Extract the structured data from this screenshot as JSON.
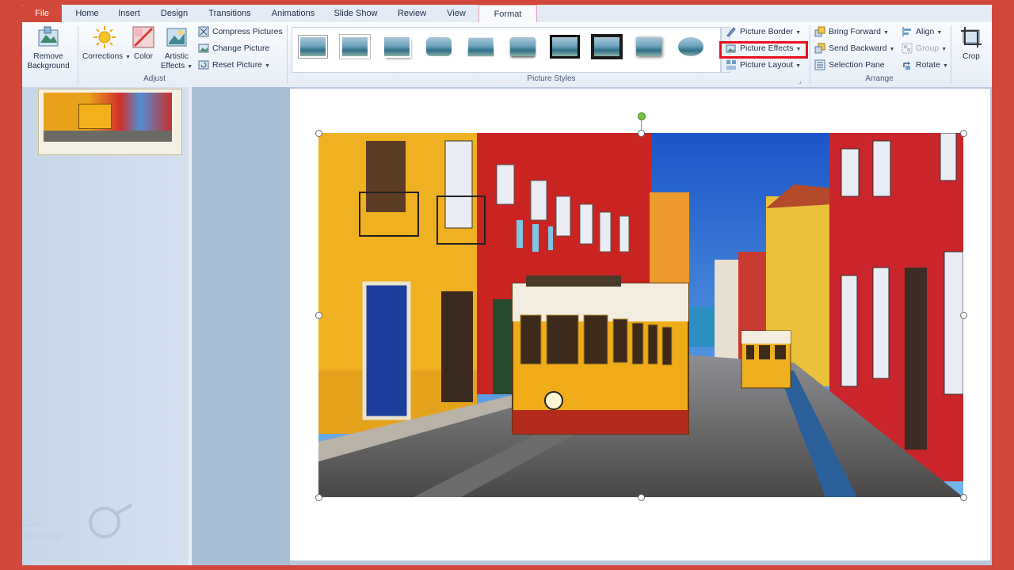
{
  "tabs": [
    "File",
    "Home",
    "Insert",
    "Design",
    "Transitions",
    "Animations",
    "Slide Show",
    "Review",
    "View",
    "Format"
  ],
  "adjust": {
    "remove_background": [
      "Remove",
      "Background"
    ],
    "corrections": "Corrections",
    "color": "Color",
    "artistic_effects": [
      "Artistic",
      "Effects"
    ],
    "compress_pictures": "Compress Pictures",
    "change_picture": "Change Picture",
    "reset_picture": "Reset Picture",
    "group_label": "Adjust"
  },
  "picture_styles": {
    "group_label": "Picture Styles",
    "picture_border": "Picture Border",
    "picture_effects": "Picture Effects",
    "picture_layout": "Picture Layout"
  },
  "arrange": {
    "group_label": "Arrange",
    "bring_forward": "Bring Forward",
    "send_backward": "Send Backward",
    "selection_pane": "Selection Pane",
    "align": "Align",
    "group": "Group",
    "rotate": "Rotate"
  },
  "size": {
    "crop": "Crop"
  },
  "watermark": {
    "text_top": "تک",
    "text_bottom": "TECH VIEW"
  },
  "colors": {
    "frame": "#d2483b",
    "highlight": "#e8101f",
    "accent_tab": "#d2483b"
  }
}
